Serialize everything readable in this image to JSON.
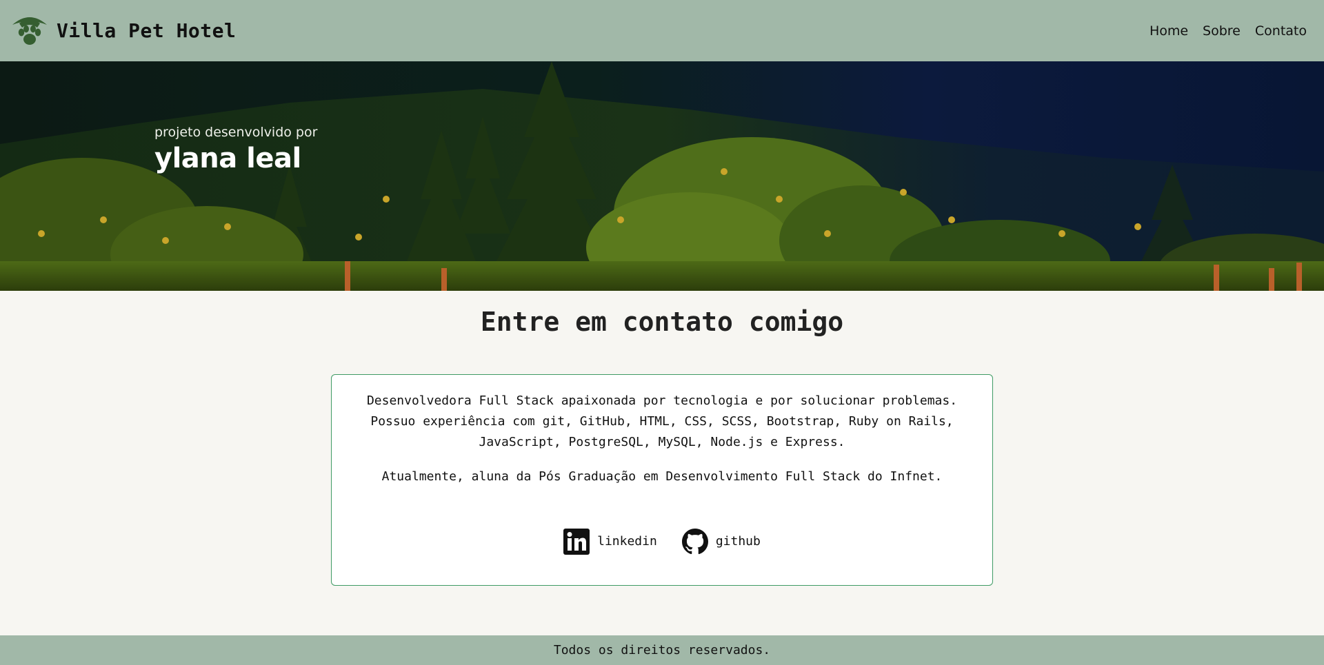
{
  "navbar": {
    "brand_name": "Villa Pet Hotel",
    "logo_icon": "paw-hat-icon",
    "links": [
      {
        "label": "Home"
      },
      {
        "label": "Sobre"
      },
      {
        "label": "Contato"
      }
    ]
  },
  "hero": {
    "subtitle": "projeto desenvolvido por",
    "name": "ylana leal",
    "image": "forest-landscape"
  },
  "main": {
    "title": "Entre em contato comigo",
    "paragraph_1": "Desenvolvedora Full Stack apaixonada por tecnologia e por solucionar problemas. Possuo experiência com git, GitHub, HTML, CSS, SCSS, Bootstrap, Ruby on Rails, JavaScript, PostgreSQL, MySQL, Node.js e Express.",
    "paragraph_2": "Atualmente, aluna da Pós Graduação em Desenvolvimento Full Stack do Infnet.",
    "socials": [
      {
        "label": "linkedin",
        "icon": "linkedin-icon"
      },
      {
        "label": "github",
        "icon": "github-icon"
      }
    ]
  },
  "footer": {
    "text": "Todos os direitos reservados."
  },
  "colors": {
    "navbar_bg": "#a1b8a8",
    "page_bg": "#f7f6f2",
    "card_border": "#3e9a63",
    "logo_green": "#355e30"
  }
}
